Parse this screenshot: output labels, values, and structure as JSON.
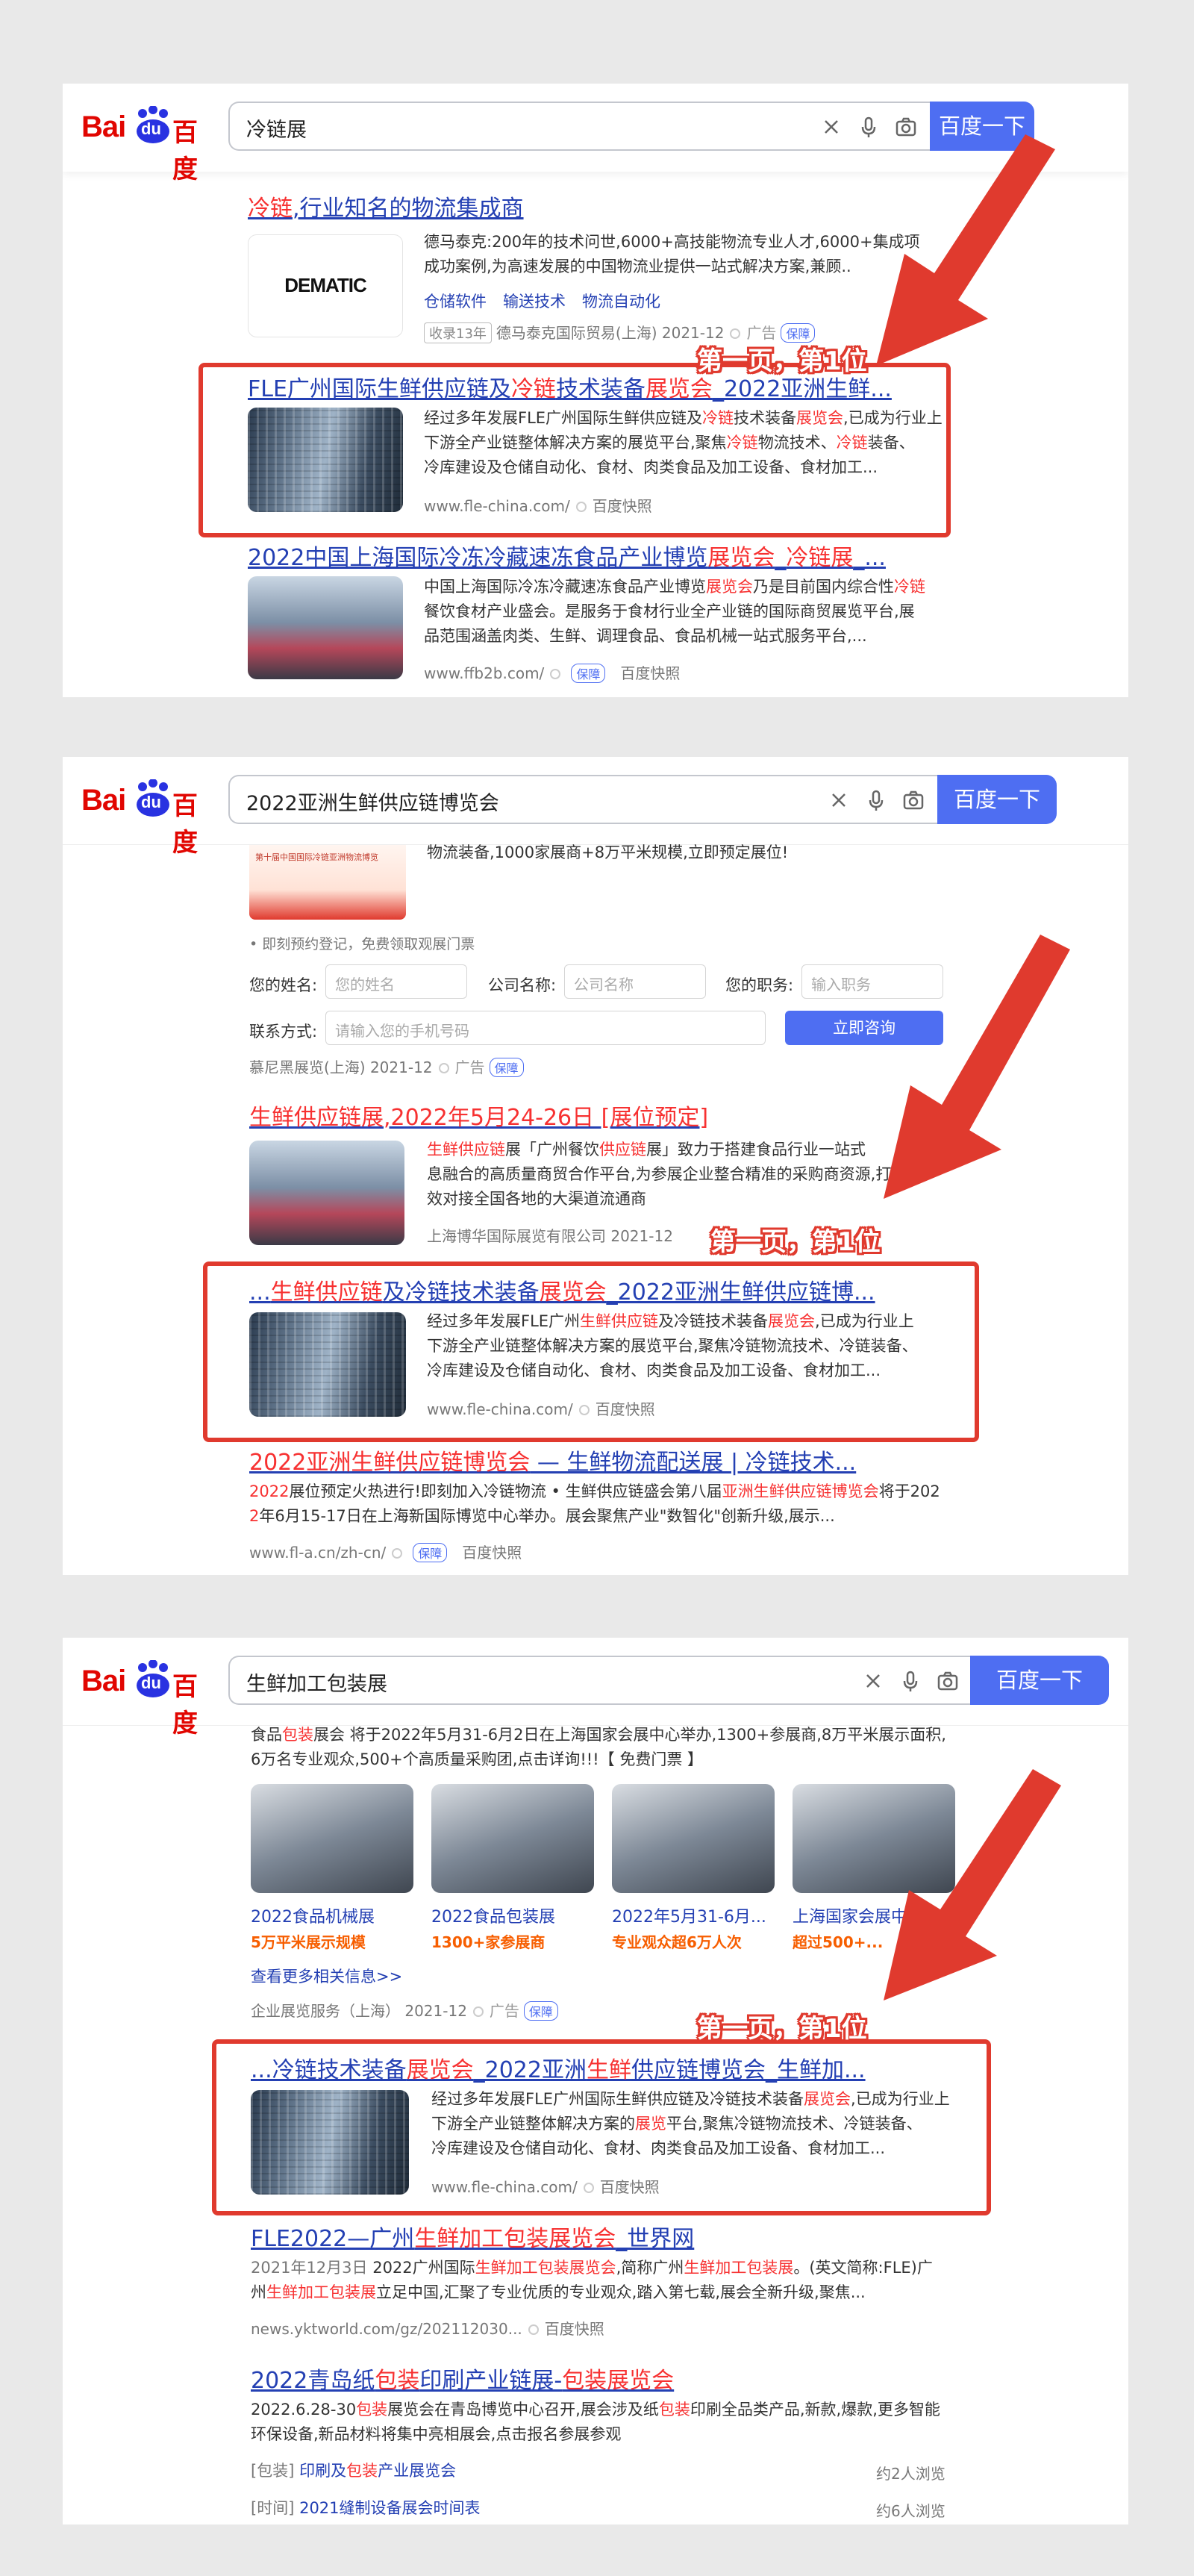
{
  "brand": {
    "logo_en": "Bai",
    "logo_du": "du",
    "logo_cn": "百度",
    "search_btn": "百度一下"
  },
  "callout": "第一页，第1位",
  "panel1": {
    "query": "冷链展",
    "r1": {
      "t1": "冷链",
      "t2": ",行业知名的物流集成商",
      "thumb": "DEMATIC",
      "d1": "德马泰克:200年的技术问世,6000+高技能物流专业人才,6000+集成项",
      "d2": "成功案例,为高速发展的中国物流业提供一站式解决方案,兼顾..",
      "links": [
        "仓储软件",
        "输送技术",
        "物流自动化"
      ],
      "badge": "收录13年",
      "src": "德马泰克国际贸易(上海) 2021-12",
      "ad": "广告",
      "bao": "保障"
    },
    "r2": {
      "a": "FLE广州国际生鲜供应链及",
      "b": "冷链",
      "c": "技术装备",
      "d": "展览会",
      "e": "_2022亚洲生鲜...",
      "l1a": "经过多年发展FLE广州国际生鲜供应链及",
      "l1b": "冷链",
      "l1c": "技术装备",
      "l1d": "展览会",
      "l1e": ",已成为行业上",
      "l2a": "下游全产业链整体解决方案的展览平台,聚焦",
      "l2b": "冷链",
      "l2c": "物流技术、",
      "l2d": "冷链",
      "l2e": "装备、",
      "l3": "冷库建设及仓储自动化、食材、肉类食品及加工设备、食材加工...",
      "url": "www.fle-china.com/",
      "snap": "百度快照"
    },
    "r3": {
      "a": "2022中国上海国际冷冻冷藏速冻食品产业博览",
      "b": "展览会",
      "c": "_",
      "d": "冷链展",
      "e": "_...",
      "l1a": "中国上海国际冷冻冷藏速冻食品产业博览",
      "l1b": "展览会",
      "l1c": "乃是目前国内综合性",
      "l1d": "冷链",
      "l2": "餐饮食材产业盛会。是服务于食材行业全产业链的国际商贸展览平台,展",
      "l3": "品范围涵盖肉类、生鲜、调理食品、食品机械一站式服务平台,...",
      "url": "www.ffb2b.com/",
      "bao": "保障",
      "snap": "百度快照"
    }
  },
  "panel2": {
    "query": "2022亚洲生鲜供应链博览会",
    "top_text": "物流装备,1000家展商+8万平米规模,立即预定展位!",
    "top_thumb": "第十届中国国际冷链亚洲物流博览",
    "note": "• 即刻预约登记，免费领取观展门票",
    "form": {
      "name_l": "您的姓名:",
      "name_p": "您的姓名",
      "co_l": "公司名称:",
      "co_p": "公司名称",
      "job_l": "您的职务:",
      "job_p": "输入职务",
      "phone_l": "联系方式:",
      "phone_p": "请输入您的手机号码",
      "btn": "立即咨询"
    },
    "src1": "慕尼黑展览(上海) 2021-12",
    "ad": "广告",
    "bao": "保障",
    "r1": {
      "a": "生鲜供应链",
      "b": "展",
      "c": ",2022年5月24-26日 [展位预定]",
      "l1a": "生鲜供应链",
      "l1b": "展「广州餐饮",
      "l1c": "供应链",
      "l1d": "展」致力于搭建食品行业一站式",
      "l2": "息融合的高质量商贸合作平台,为参展企业整合精准的采购商资源,打造高",
      "l3": "效对接全国各地的大渠道流通商",
      "src": "上海博华国际展览有限公司 2021-12"
    },
    "r2": {
      "a": "...",
      "b": "生鲜供应链",
      "c": "及冷链技术装备",
      "d": "展览会",
      "e": "_2022亚洲生鲜供应链博...",
      "l1a": "经过多年发展FLE广州",
      "l1b": "生鲜供应链",
      "l1c": "及冷链技术装备",
      "l1d": "展览会",
      "l1e": ",已成为行业上",
      "l2": "下游全产业链整体解决方案的展览平台,聚焦冷链物流技术、冷链装备、",
      "l3": "冷库建设及仓储自动化、食材、肉类食品及加工设备、食材加工...",
      "url": "www.fle-china.com/",
      "snap": "百度快照"
    },
    "r3": {
      "a": "2022亚洲生鲜供应链博览会",
      "b": " — 生鲜物流配送展 | 冷链技术...",
      "l1a": "2022",
      "l1b": "展位预定火热进行!即刻加入冷链物流 • 生鲜供应链盛会第八届",
      "l1c": "亚洲生鲜供应链博览会",
      "l1d": "将于202",
      "l2a": "2",
      "l2b": "年6月15-17日在上海新国际博览中心举办。展会聚焦产业\"数智化\"创新升级,展示...",
      "url": "www.fl-a.cn/zh-cn/",
      "bao": "保障",
      "snap": "百度快照"
    }
  },
  "panel3": {
    "query": "生鲜加工包装展",
    "top_l1a": "食品",
    "top_l1b": "包装",
    "top_l1c": "展会 将于2022年5月31-6月2日在上海国家会展中心举办,1300+参展商,8万平米展示面积,",
    "top_l2": "6万名专业观众,500+个高质量采购团,点击详询!!!【 免费门票 】",
    "imgs": [
      {
        "cap": "2022食品机械展",
        "sub": "5万平米展示规模"
      },
      {
        "cap": "2022食品包装展",
        "sub": "1300+家参展商"
      },
      {
        "cap": "2022年5月31-6月...",
        "sub": "专业观众超6万人次"
      },
      {
        "cap": "上海国家会展中心",
        "sub": "超过500+..."
      }
    ],
    "more": "查看更多相关信息>>",
    "src1": "企业展览服务（上海） 2021-12",
    "ad": "广告",
    "bao": "保障",
    "r1": {
      "a": "...冷链技术装备",
      "b": "展览会",
      "c": "_2022亚洲",
      "d": "生鲜",
      "e": "供应链博览会_生鲜加...",
      "l1a": "经过多年发展FLE广州国际生鲜供应链及冷链技术装备",
      "l1b": "展览会",
      "l1c": ",已成为行业上",
      "l2a": "下游全产业链整体解决方案的",
      "l2b": "展览",
      "l2c": "平台,聚焦冷链物流技术、冷链装备、",
      "l3": "冷库建设及仓储自动化、食材、肉类食品及加工设备、食材加工...",
      "url": "www.fle-china.com/",
      "snap": "百度快照"
    },
    "r2": {
      "a": "FLE2022—广州",
      "b": "生鲜加工包装展览会",
      "c": "_世界网",
      "l1a": "2021年12月3日 ",
      "l1b": "2022广州国际",
      "l1c": "生鲜加工包装展览会",
      "l1d": ",简称广州",
      "l1e": "生鲜加工包装展",
      "l1f": "。(英文简称:FLE)广",
      "l2a": "州",
      "l2b": "生鲜加工包装展",
      "l2c": "立足中国,汇聚了专业优质的专业观众,踏入第七载,展会全新升级,聚焦...",
      "url": "news.yktworld.com/gz/202112030...",
      "snap": "百度快照"
    },
    "r3": {
      "a": "2022青岛纸",
      "b": "包装",
      "c": "印刷产业链展-",
      "d": "包装展览会",
      "l1a": "2022.6.28-30",
      "l1b": "包装",
      "l1c": "展览会在青岛博览中心召开,展会涉及纸",
      "l1d": "包装",
      "l1e": "印刷全品类产品,新款,爆款,更多智能",
      "l2": "环保设备,新品材料将集中亮相展会,点击报名参展参观",
      "rel": [
        {
          "tag": "[包装]",
          "a": "印刷及",
          "b": "包装",
          "c": "产业展览会",
          "cnt": "约2人浏览"
        },
        {
          "tag": "[时间]",
          "a": "2021缝制设备展会时间表",
          "b": "",
          "c": "",
          "cnt": "约6人浏览"
        }
      ]
    }
  }
}
